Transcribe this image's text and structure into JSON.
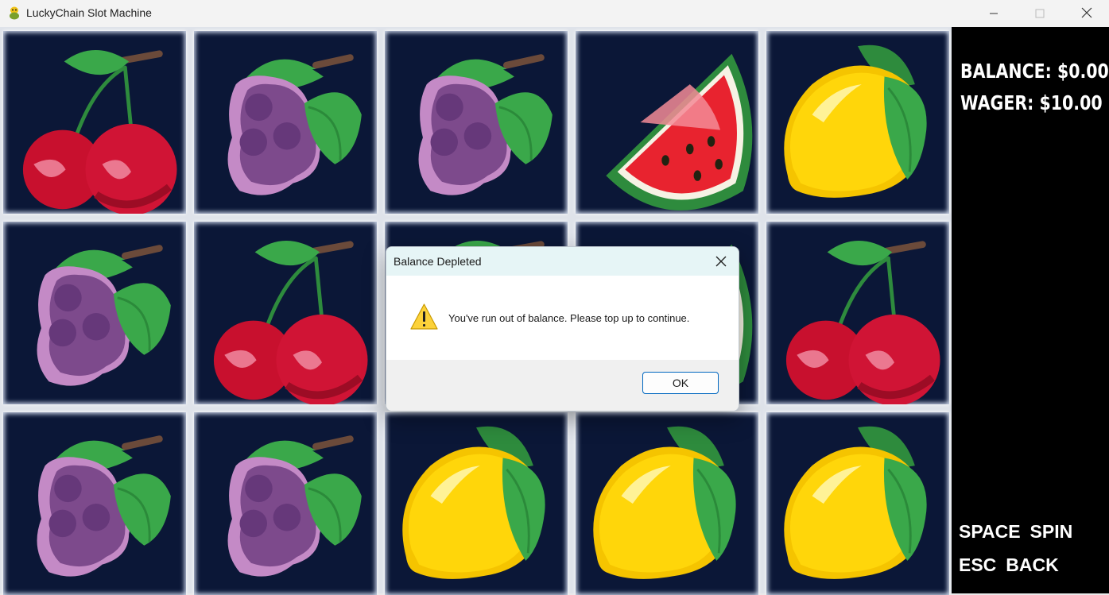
{
  "window": {
    "title": "LuckyChain Slot Machine",
    "app_icon": "snake-icon",
    "controls": [
      "minimize-icon",
      "maximize-icon",
      "close-icon"
    ]
  },
  "reels": [
    [
      "cherry",
      "grape",
      "grape",
      "watermelon",
      "lemon"
    ],
    [
      "grape",
      "cherry",
      "cherry",
      "watermelon",
      "cherry"
    ],
    [
      "grape",
      "grape",
      "lemon",
      "lemon",
      "lemon"
    ]
  ],
  "hud": {
    "balance": "BALANCE: $0.00",
    "wager": "WAGER: $10.00",
    "hints": [
      {
        "key": "SPACE",
        "action": "SPIN"
      },
      {
        "key": "ESC",
        "action": "BACK"
      }
    ]
  },
  "dialog": {
    "title": "Balance Depleted",
    "icon": "warning-icon",
    "message": "You've run out of balance. Please top up to continue.",
    "ok_label": "OK"
  },
  "colors": {
    "cell_background": "#0b1737",
    "panel_background": "#000000",
    "dialog_header": "#e6f5f6",
    "ok_border": "#0067c0"
  }
}
